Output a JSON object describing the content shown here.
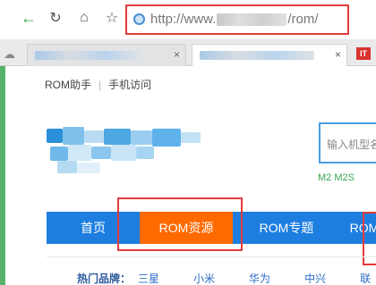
{
  "browser": {
    "address": {
      "url_prefix": "http://www.",
      "url_suffix": "/rom/"
    },
    "tab_it_label": "IT",
    "tab_close_glyph": "×"
  },
  "topnav": {
    "items": [
      "ROM助手",
      "手机访问"
    ],
    "separator": "|"
  },
  "search": {
    "placeholder": "输入机型名"
  },
  "hotwords": "M2 M2S",
  "mainnav": {
    "items": [
      "首页",
      "ROM资源",
      "ROM专题",
      "ROM"
    ]
  },
  "brands": {
    "label": "热门品牌：",
    "items": [
      "三星",
      "小米",
      "华为",
      "中兴",
      "联"
    ]
  },
  "colors": {
    "nav_blue": "#1e7ee0",
    "nav_active": "#ff6a00",
    "highlight_red": "#e23b3b",
    "link_blue": "#2b6cc4",
    "hot_green": "#3aa550"
  }
}
